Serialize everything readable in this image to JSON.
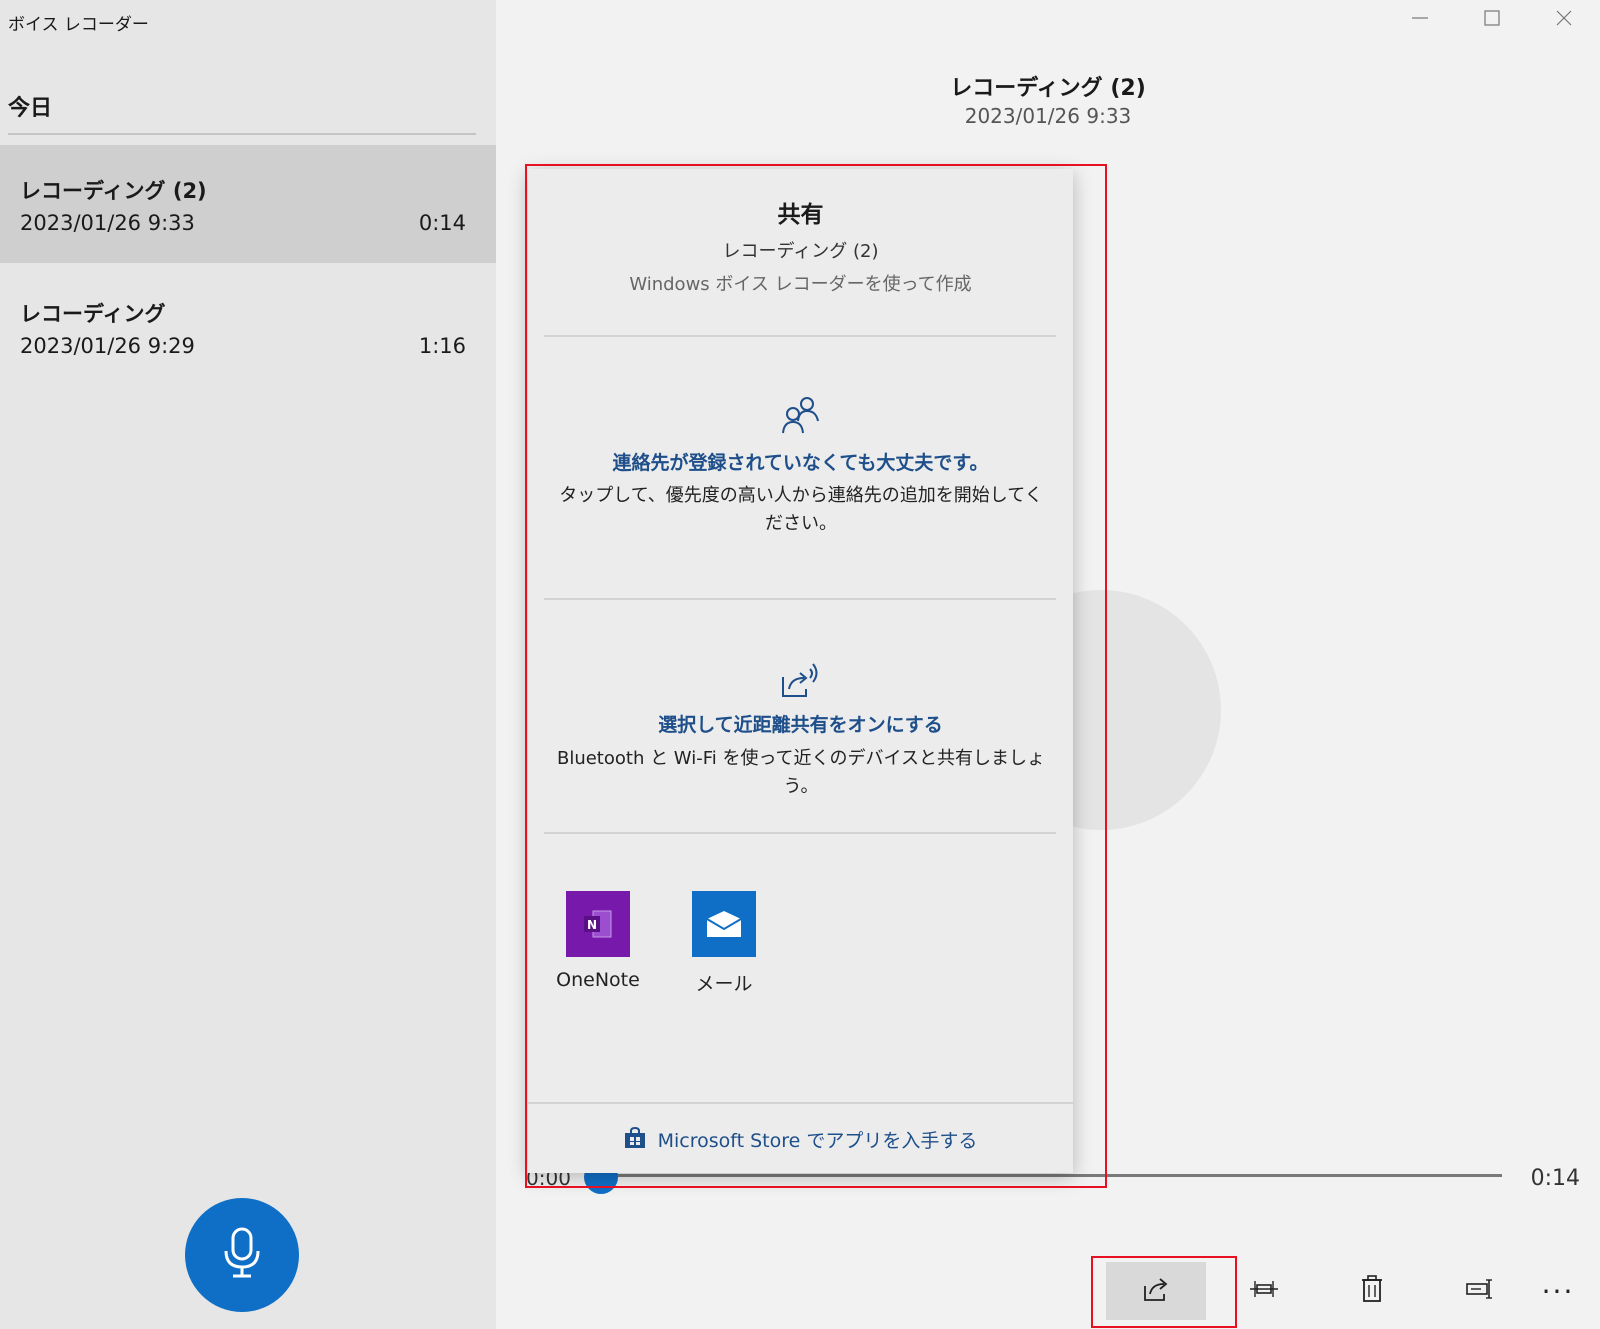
{
  "app": {
    "title": "ボイス レコーダー",
    "accent_color": "#0f6fc6"
  },
  "sidebar": {
    "section_header": "今日",
    "recordings": [
      {
        "name": "レコーディング (2)",
        "date": "2023/01/26 9:33",
        "duration": "0:14",
        "selected": true
      },
      {
        "name": "レコーディング",
        "date": "2023/01/26 9:29",
        "duration": "1:16",
        "selected": false
      }
    ],
    "record_button_icon": "microphone-icon"
  },
  "window_controls": {
    "icons": [
      "minimize-icon",
      "maximize-icon",
      "close-icon"
    ]
  },
  "player": {
    "title": "レコーディング (2)",
    "subtitle": "2023/01/26 9:33",
    "time_current": "0:00",
    "time_total": "0:14",
    "progress_fraction": 0.0
  },
  "toolbar": {
    "buttons": [
      {
        "icon": "share-icon",
        "active": true
      },
      {
        "icon": "trim-icon",
        "active": false
      },
      {
        "icon": "trash-icon",
        "active": false
      },
      {
        "icon": "rename-icon",
        "active": false
      },
      {
        "icon": "more-icon",
        "active": false
      }
    ],
    "more_label": "···"
  },
  "share_panel": {
    "title": "共有",
    "item_name": "レコーディング (2)",
    "subtitle": "Windows ボイス レコーダーを使って作成",
    "contacts": {
      "icon": "people-icon",
      "heading": "連絡先が登録されていなくても大丈夫です。",
      "description": "タップして、優先度の高い人から連絡先の追加を開始してください。"
    },
    "nearby": {
      "icon": "nearby-share-icon",
      "heading": "選択して近距離共有をオンにする",
      "description": "Bluetooth と Wi-Fi を使って近くのデバイスと共有しましょう。"
    },
    "apps": [
      {
        "label": "OneNote",
        "icon": "onenote-icon",
        "color": "#7719aa",
        "letter": "N"
      },
      {
        "label": "メール",
        "icon": "mail-icon",
        "color": "#0f6fc6"
      }
    ],
    "store": {
      "icon": "store-bag-icon",
      "label": "Microsoft Store でアプリを入手する"
    }
  }
}
